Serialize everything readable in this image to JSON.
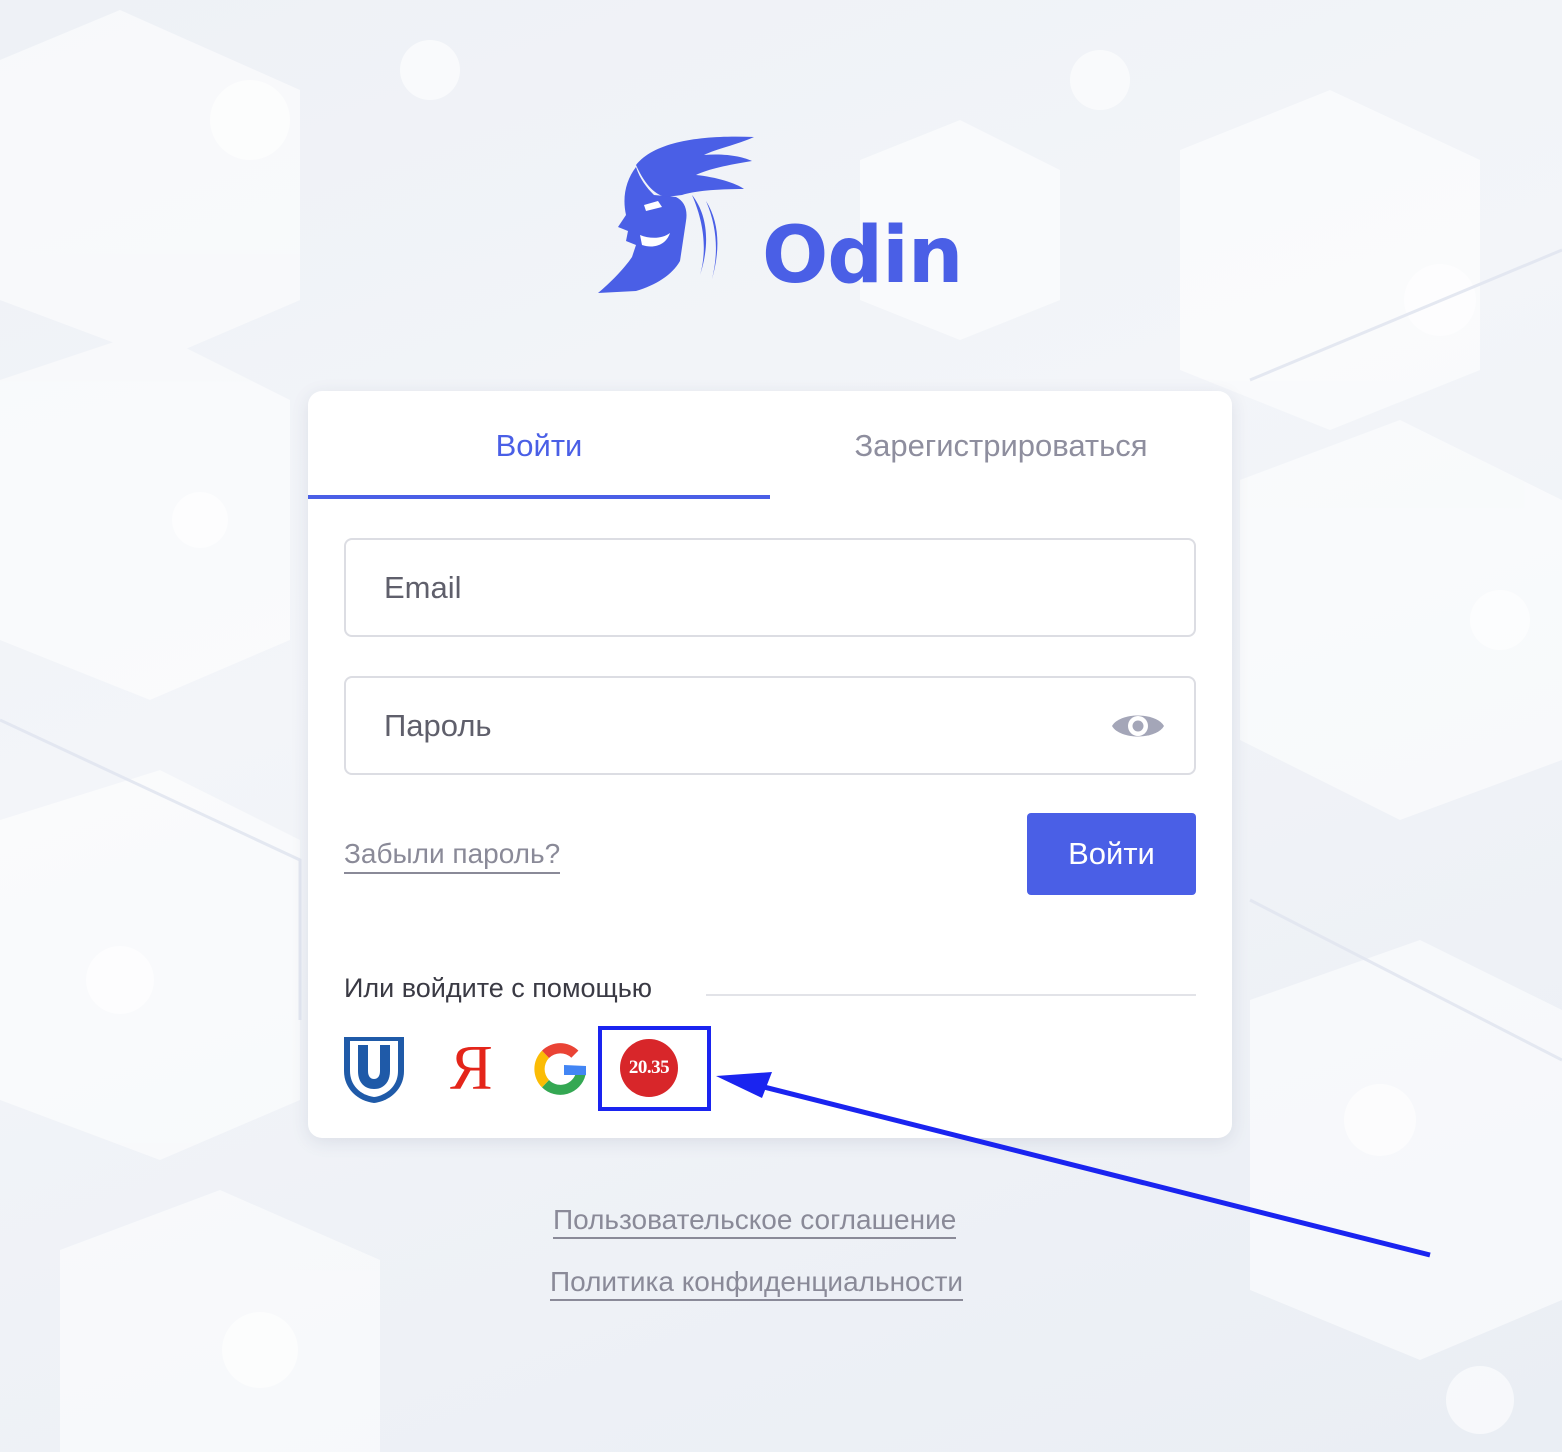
{
  "brand": {
    "name": "Odin",
    "color": "#4a5fe6"
  },
  "tabs": {
    "login": "Войти",
    "register": "Зарегистрироваться"
  },
  "form": {
    "email_placeholder": "Email",
    "password_placeholder": "Пароль",
    "forgot_label": "Забыли пароль?",
    "submit_label": "Войти"
  },
  "social": {
    "label": "Или войдите с помощью",
    "providers": [
      {
        "icon": "tusur-u-icon"
      },
      {
        "icon": "yandex-icon",
        "glyph": "Я"
      },
      {
        "icon": "google-icon"
      },
      {
        "icon": "university-2035-icon",
        "text": "20.35"
      }
    ]
  },
  "footer": {
    "terms": "Пользовательское соглашение",
    "privacy": "Политика конфиденциальности"
  },
  "annotation": {
    "highlight_color": "#1a24f0"
  }
}
